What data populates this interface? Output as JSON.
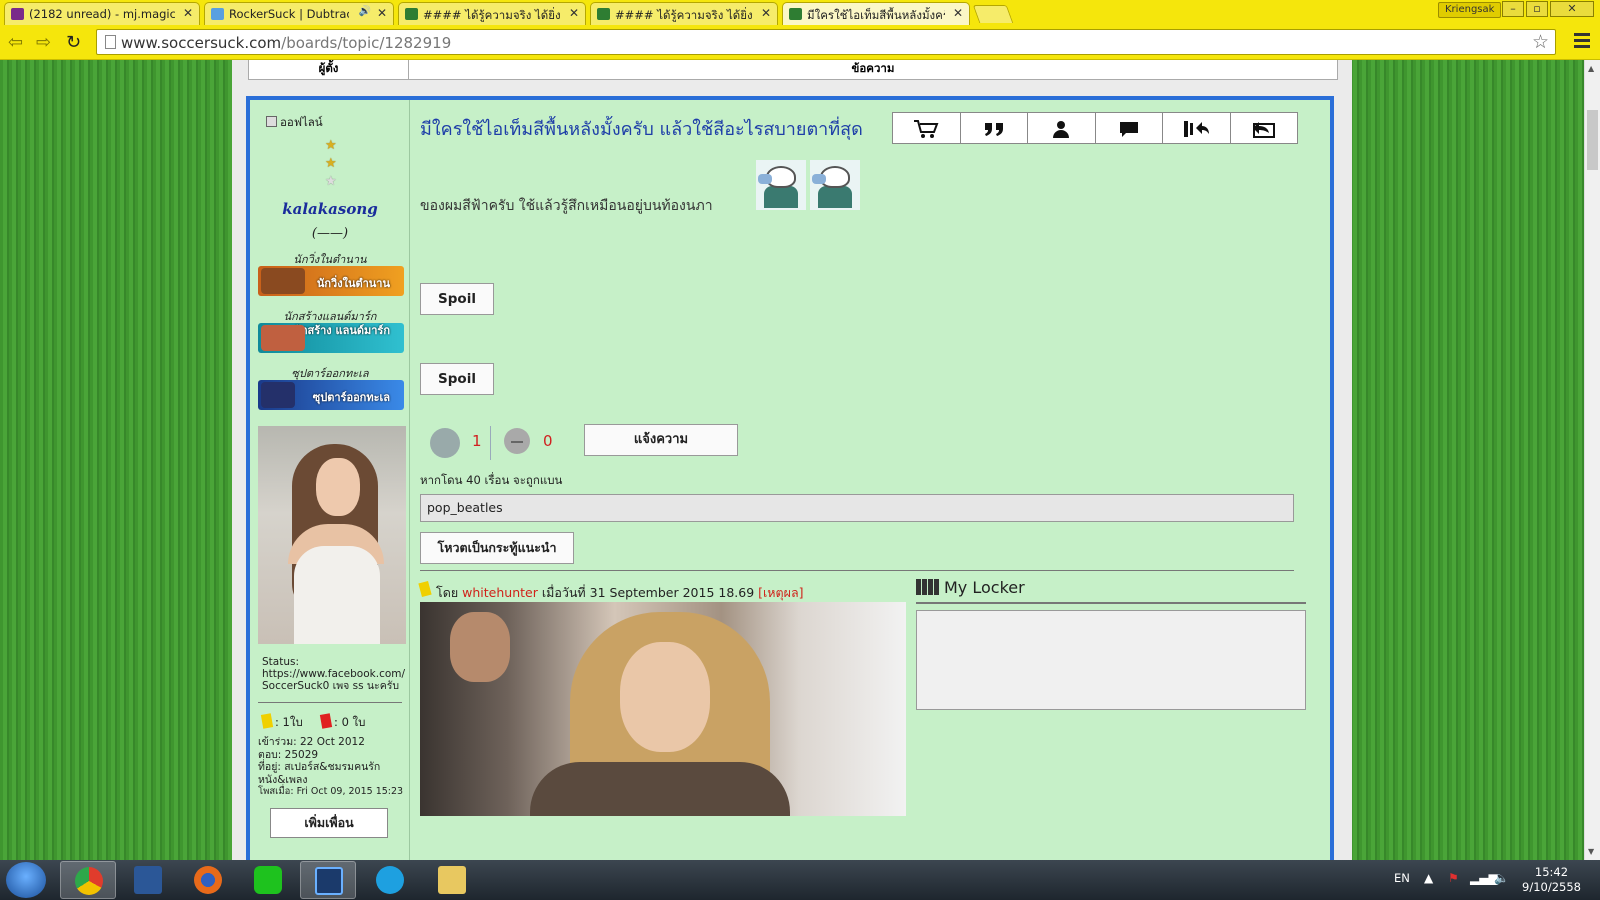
{
  "browser": {
    "tabs": [
      {
        "label": "(2182 unread) - mj.magica",
        "favicon_color": "#7a2a8a",
        "active": false
      },
      {
        "label": "RockerSuck | Dubtrack",
        "favicon_color": "#5aa0e0",
        "active": false,
        "audio_icon": "🔊"
      },
      {
        "label": "#### ได้รู้ความจริง ได้ยิ่งกว่า",
        "favicon_color": "#2e7d32",
        "active": false
      },
      {
        "label": "#### ได้รู้ความจริง ได้ยิ่งกว่า",
        "favicon_color": "#2e7d32",
        "active": false
      },
      {
        "label": "มีใครใช้ไอเท็มสีพื้นหลังมั้งครับ",
        "favicon_color": "#2e7d32",
        "active": true
      }
    ],
    "close_glyph": "✕",
    "user_badge": "Kriengsak",
    "url_domain": "www.soccersuck.com",
    "url_path": "/boards/topic/1282919"
  },
  "table_header": {
    "author": "ผู้ตั้ง",
    "message": "ข้อความ"
  },
  "user": {
    "status": "ออฟไลน์",
    "name": "kalakasong",
    "title": "(——)",
    "badges": [
      {
        "caption": "นักวิ่งในตำนาน",
        "label": "นักวิ่งในตำนาน",
        "color": "#e87a10"
      },
      {
        "caption": "นักสร้างแลนด์มาร์ก",
        "label": "นักสร้าง แลนด์มาร์ก",
        "color": "#1aa0b0"
      },
      {
        "caption": "ซุปตาร์ออกทะเล",
        "label": "ซุปตาร์ออกทะเล",
        "color": "#2a6ed8"
      }
    ],
    "status_text": "Status: https://www.facebook.com/ SoccerSuck0 เพจ ss นะครับ",
    "yellow_cards": ": 1ใบ",
    "red_cards": ": 0 ใบ",
    "joined": "เข้าร่วม: 22 Oct 2012",
    "posts": "ตอบ: 25029",
    "location": "ที่อยู่: สเปอร์ส&ชมรมคนรักหนัง&เพลง",
    "posted": "โพสเมื่อ: Fri Oct 09, 2015 15:23",
    "add_friend": "เพิ่มเพื่อน"
  },
  "post": {
    "title": "มีใครใช้ไอเท็มสีพื้นหลังมั้งครับ แล้วใช้สีอะไรสบายตาที่สุด",
    "actions": [
      "cart-icon",
      "quote-icon",
      "profile-icon",
      "message-icon",
      "reply-icon",
      "back-icon"
    ],
    "body": "ของผมสีฟ้าครับ ใช้แล้วรู้สึกเหมือนอยู่บนท้องนภา",
    "spoil_1": "Spoil",
    "spoil_2": "Spoil",
    "likes": "1",
    "dislikes": "0",
    "report": "แจ้งความ",
    "ban_note": "หากโดน 40 เรื่อน จะถูกแบน",
    "poster_field": "pop_beatles",
    "vote_btn": "โหวตเป็นกระทู้แนะนำ",
    "card_by": "โดย",
    "card_user": "whitehunter",
    "card_date": "เมื่อวันที่ 31 September 2015 18.69",
    "card_reason": "[เหตุผล]",
    "locker_title": "My Locker"
  },
  "taskbar": {
    "apps": [
      {
        "name": "chrome",
        "color": "#e03c2c",
        "active": true
      },
      {
        "name": "word",
        "color": "#2b5797",
        "active": false
      },
      {
        "name": "firefox",
        "color": "#e86a1a",
        "active": false
      },
      {
        "name": "line",
        "color": "#1ec21e",
        "active": false
      },
      {
        "name": "photoshop",
        "color": "#1b3a6b",
        "active": true
      },
      {
        "name": "skype",
        "color": "#1ea0e0",
        "active": false
      },
      {
        "name": "explorer",
        "color": "#e8c860",
        "active": false
      }
    ],
    "lang": "EN",
    "time": "15:42",
    "date": "9/10/2558"
  }
}
